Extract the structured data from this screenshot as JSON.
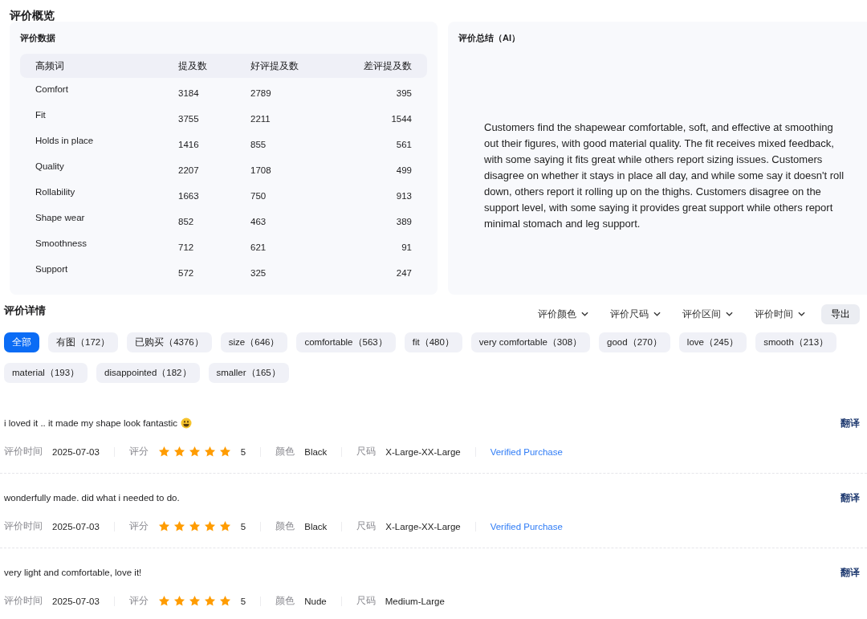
{
  "overview": {
    "title": "评价概览",
    "data_card": {
      "title": "评价数据",
      "columns": [
        "高频词",
        "提及数",
        "好评提及数",
        "差评提及数"
      ],
      "rows": [
        [
          "Comfort",
          "3184",
          "2789",
          "395"
        ],
        [
          "Fit",
          "3755",
          "2211",
          "1544"
        ],
        [
          "Holds in place",
          "1416",
          "855",
          "561"
        ],
        [
          "Quality",
          "2207",
          "1708",
          "499"
        ],
        [
          "Rollability",
          "1663",
          "750",
          "913"
        ],
        [
          "Shape wear",
          "852",
          "463",
          "389"
        ],
        [
          "Smoothness",
          "712",
          "621",
          "91"
        ],
        [
          "Support",
          "572",
          "325",
          "247"
        ]
      ]
    },
    "summary_card": {
      "title": "评价总结（AI）",
      "text": "Customers find the shapewear comfortable, soft, and effective at smoothing out their figures, with good material quality. The fit receives mixed feedback, with some saying it fits great while others report sizing issues. Customers disagree on whether it stays in place all day, and while some say it doesn't roll down, others report it rolling up on the thighs. Customers disagree on the support level, with some saying it provides great support while others report minimal stomach and leg support."
    }
  },
  "details": {
    "title": "评价详情",
    "filters": [
      "评价颜色",
      "评价尺码",
      "评价区间",
      "评价时间"
    ],
    "export_button": "导出",
    "tags": [
      {
        "label": "全部",
        "selected": true
      },
      {
        "label": "有图（172）",
        "selected": false
      },
      {
        "label": "已购买（4376）",
        "selected": false
      },
      {
        "label": "size（646）",
        "selected": false
      },
      {
        "label": "comfortable（563）",
        "selected": false
      },
      {
        "label": "fit（480）",
        "selected": false
      },
      {
        "label": "very comfortable（308）",
        "selected": false
      },
      {
        "label": "good（270）",
        "selected": false
      },
      {
        "label": "love（245）",
        "selected": false
      },
      {
        "label": "smooth（213）",
        "selected": false
      },
      {
        "label": "material（193）",
        "selected": false
      },
      {
        "label": "disappointed（182）",
        "selected": false
      },
      {
        "label": "smaller（165）",
        "selected": false
      }
    ],
    "reviews": [
      {
        "text": "i loved it .. it made my shape look fantastic",
        "emoji": true,
        "translate": "翻译",
        "date_label": "评价时间",
        "date": "2025-07-03",
        "rating_label": "评分",
        "stars": 5,
        "rating": "5",
        "color_label": "颜色",
        "color_value": "Black",
        "size_label": "尺码",
        "size": "X-Large-XX-Large",
        "badge": "Verified Purchase"
      },
      {
        "text": "wonderfully made. did what i needed to do.",
        "emoji": false,
        "translate": "翻译",
        "date_label": "评价时间",
        "date": "2025-07-03",
        "rating_label": "评分",
        "stars": 5,
        "rating": "5",
        "color_label": "颜色",
        "color_value": "Black",
        "size_label": "尺码",
        "size": "X-Large-XX-Large",
        "badge": "Verified Purchase"
      },
      {
        "text": "very light and comfortable, love it!",
        "emoji": false,
        "translate": "翻译",
        "date_label": "评价时间",
        "date": "2025-07-03",
        "rating_label": "评分",
        "stars": 5,
        "rating": "5",
        "color_label": "颜色",
        "color_value": "Nude",
        "size_label": "尺码",
        "size": "Medium-Large"
      }
    ]
  }
}
